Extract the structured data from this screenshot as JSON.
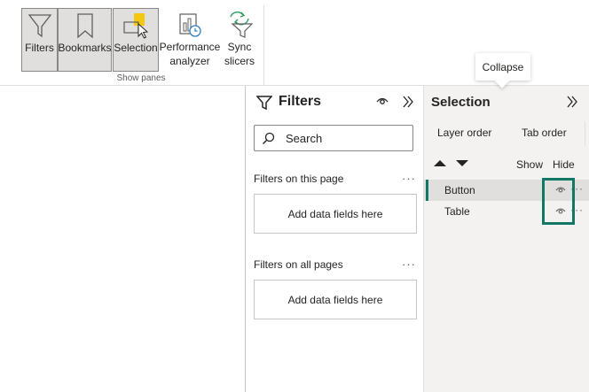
{
  "ribbon": {
    "buttons": {
      "filters": "Filters",
      "bookmarks": "Bookmarks",
      "selection": "Selection",
      "performance_line1": "Performance",
      "performance_line2": "analyzer",
      "sync_line1": "Sync",
      "sync_line2": "slicers"
    },
    "group_label": "Show panes"
  },
  "tooltip": {
    "text": "Collapse"
  },
  "filters_pane": {
    "title": "Filters",
    "search_placeholder": "Search",
    "sections": [
      {
        "label": "Filters on this page",
        "well": "Add data fields here"
      },
      {
        "label": "Filters on all pages",
        "well": "Add data fields here"
      }
    ],
    "more": "···"
  },
  "selection_pane": {
    "title": "Selection",
    "tabs": {
      "layer_order": "Layer order",
      "tab_order": "Tab order"
    },
    "columns": {
      "show": "Show",
      "hide": "Hide"
    },
    "layers": [
      {
        "name": "Button",
        "selected": true
      },
      {
        "name": "Table",
        "selected": false
      }
    ],
    "more": "···"
  },
  "colors": {
    "accent": "#117865",
    "ribbon_selected": "#e1dfdd",
    "pane_bg": "#f3f2f1",
    "bookmark_highlight": "#f2c811"
  },
  "icons": {
    "filters": "funnel-icon",
    "bookmarks": "bookmark-icon",
    "selection": "selection-pointer-icon",
    "performance": "performance-chart-icon",
    "sync": "sync-slicers-icon",
    "visibility": "eye-icon",
    "expand": "double-chevron-right-icon",
    "search": "search-icon"
  }
}
